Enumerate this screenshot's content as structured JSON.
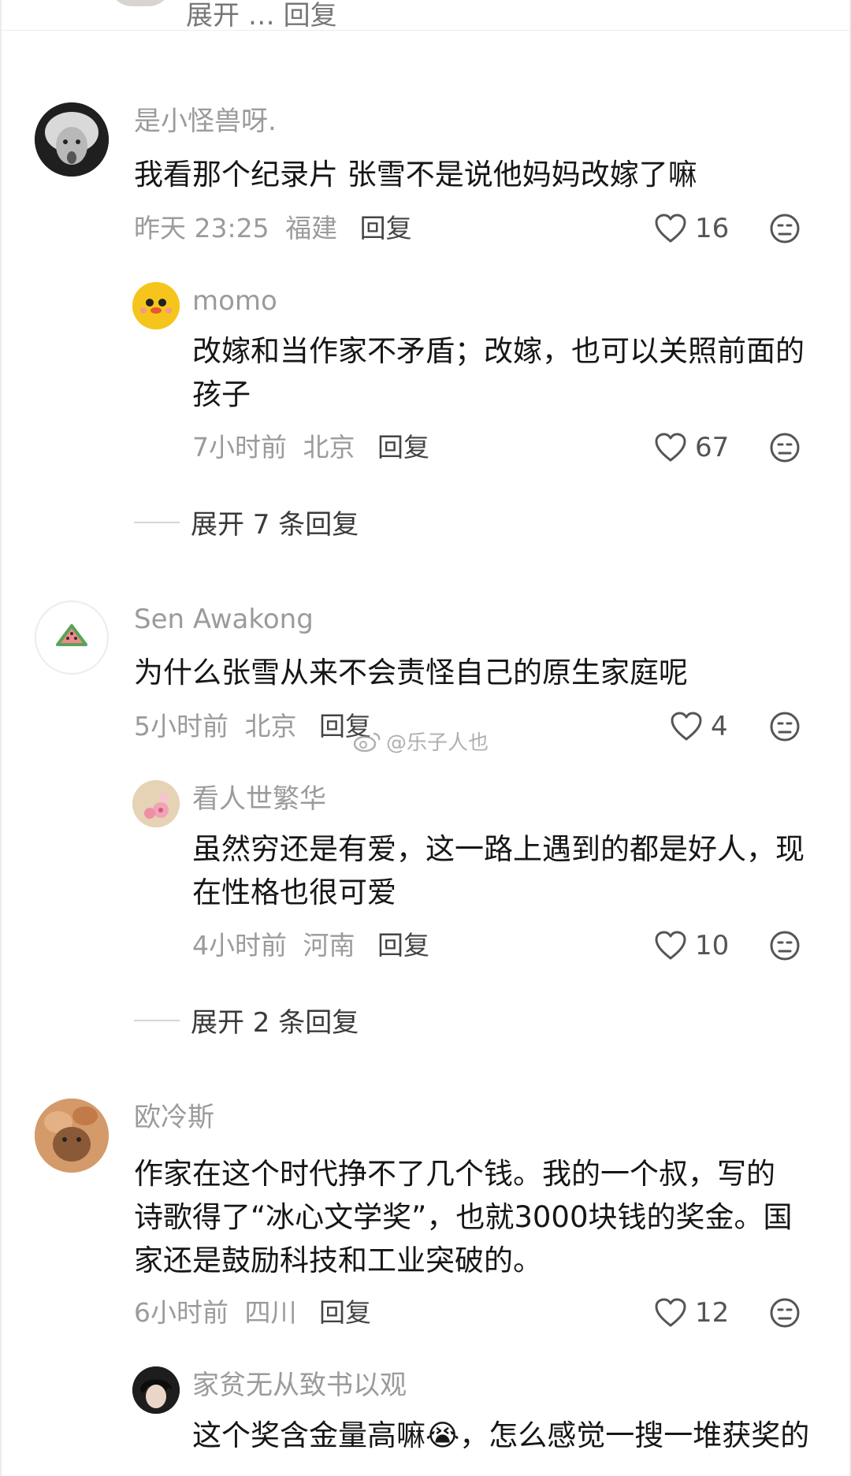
{
  "top_partial": {
    "text": "展开 … 回复"
  },
  "comments": [
    {
      "username": "是小怪兽呀.",
      "content": "我看那个纪录片 张雪不是说他妈妈改嫁了嘛",
      "time": "昨天 23:25",
      "location": "福建",
      "reply_label": "回复",
      "likes": "16",
      "avatar_icon": "einstein-photo-avatar",
      "sub_reply": {
        "username": "momo",
        "content": "改嫁和当作家不矛盾；改嫁，也可以关照前面的孩子",
        "time": "7小时前",
        "location": "北京",
        "reply_label": "回复",
        "likes": "67",
        "avatar_icon": "yellow-chick-avatar"
      },
      "expand_label": "展开 7 条回复"
    },
    {
      "username": "Sen Awakong",
      "content": "为什么张雪从来不会责怪自己的原生家庭呢",
      "time": "5小时前",
      "location": "北京",
      "reply_label": "回复",
      "likes": "4",
      "avatar_icon": "watermelon-avatar",
      "sub_reply": {
        "username": "看人世繁华",
        "content": "虽然穷还是有爱，这一路上遇到的都是好人，现在性格也很可爱",
        "time": "4小时前",
        "location": "河南",
        "reply_label": "回复",
        "likes": "10",
        "avatar_icon": "flower-avatar"
      },
      "expand_label": "展开 2 条回复"
    },
    {
      "username": "欧冷斯",
      "content": "作家在这个时代挣不了几个钱。我的一个叔，写的诗歌得了“冰心文学奖”，也就3000块钱的奖金。国家还是鼓励科技和工业突破的。",
      "time": "6小时前",
      "location": "四川",
      "reply_label": "回复",
      "likes": "12",
      "avatar_icon": "capybara-avatar",
      "sub_reply": {
        "username": "家贫无从致书以观",
        "content": "这个奖含金量高嘛😭，怎么感觉一搜一堆获奖的",
        "avatar_icon": "anime-boy-avatar"
      }
    }
  ],
  "watermark": "@乐子人也",
  "colors": {
    "meta": "#9b9b9b",
    "text": "#161616",
    "background": "#ffffff"
  }
}
